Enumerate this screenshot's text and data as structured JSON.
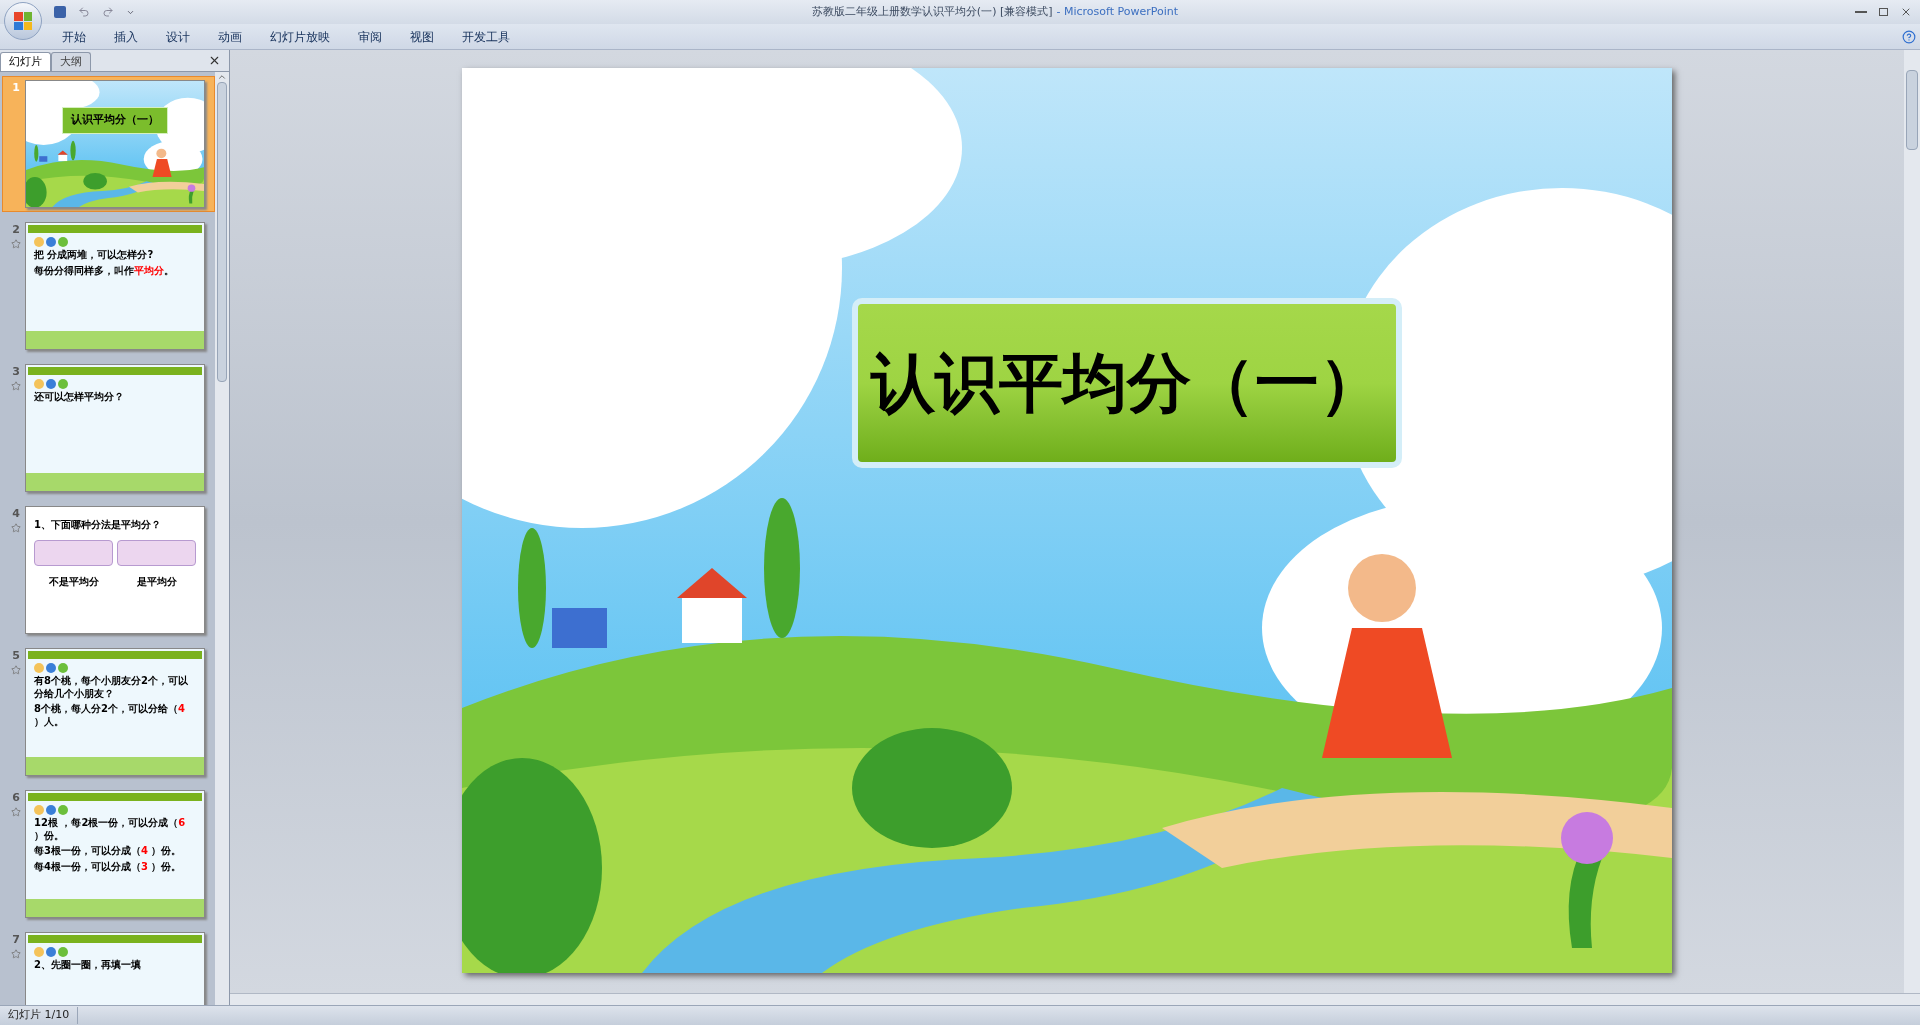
{
  "window": {
    "title": "苏教版二年级上册数学认识平均分(一) [兼容模式]",
    "app_name": "- Microsoft PowerPoint"
  },
  "ribbon_tabs": [
    "开始",
    "插入",
    "设计",
    "动画",
    "幻灯片放映",
    "审阅",
    "视图",
    "开发工具"
  ],
  "panel_tabs": [
    {
      "label": "幻灯片",
      "selected": true
    },
    {
      "label": "大纲",
      "selected": false
    }
  ],
  "thumbnails": [
    {
      "number": "1",
      "selected": true,
      "animated": false,
      "kind": "title",
      "title": "认识平均分（一）"
    },
    {
      "number": "2",
      "selected": false,
      "animated": true,
      "kind": "content",
      "lines": [
        [
          {
            "text": "把 分成两堆，可以怎样分?",
            "highlight": false
          }
        ],
        [
          {
            "text": "每份分得同样多，叫作",
            "highlight": false
          },
          {
            "text": "平均分",
            "highlight": true
          },
          {
            "text": "。",
            "highlight": false
          }
        ]
      ]
    },
    {
      "number": "3",
      "selected": false,
      "animated": true,
      "kind": "content",
      "lines": [
        [
          {
            "text": "还可以怎样平均分？",
            "highlight": false
          }
        ]
      ]
    },
    {
      "number": "4",
      "selected": false,
      "animated": true,
      "kind": "plain",
      "lines": [
        [
          {
            "text": "1、下面哪种分法是平均分？",
            "highlight": false
          }
        ]
      ],
      "captions": [
        "不是平均分",
        "是平均分"
      ]
    },
    {
      "number": "5",
      "selected": false,
      "animated": true,
      "kind": "content",
      "lines": [
        [
          {
            "text": "有8个桃，每个小朋友分2个，可以分给几个小朋友？",
            "highlight": false
          }
        ],
        [
          {
            "text": "8个桃，每人分2个，可以分给（",
            "highlight": false
          },
          {
            "text": "4",
            "highlight": true
          },
          {
            "text": " ）人。",
            "highlight": false
          }
        ]
      ]
    },
    {
      "number": "6",
      "selected": false,
      "animated": true,
      "kind": "content",
      "lines": [
        [
          {
            "text": "12根 ，每2根一份，可以分成（",
            "highlight": false
          },
          {
            "text": "6",
            "highlight": true
          },
          {
            "text": " ）份。",
            "highlight": false
          }
        ],
        [
          {
            "text": "每3根一份，可以分成（",
            "highlight": false
          },
          {
            "text": "4",
            "highlight": true
          },
          {
            "text": " ）份。",
            "highlight": false
          }
        ],
        [
          {
            "text": "每4根一份，可以分成（",
            "highlight": false
          },
          {
            "text": "3",
            "highlight": true
          },
          {
            "text": " ）份。",
            "highlight": false
          }
        ]
      ]
    },
    {
      "number": "7",
      "selected": false,
      "animated": true,
      "kind": "content",
      "lines": [
        [
          {
            "text": "2、先圈一圈，再填一填",
            "highlight": false
          }
        ]
      ]
    }
  ],
  "slide": {
    "title": "认识平均分（一）"
  },
  "status_bar": {
    "slide_count": "幻灯片 1/10"
  }
}
